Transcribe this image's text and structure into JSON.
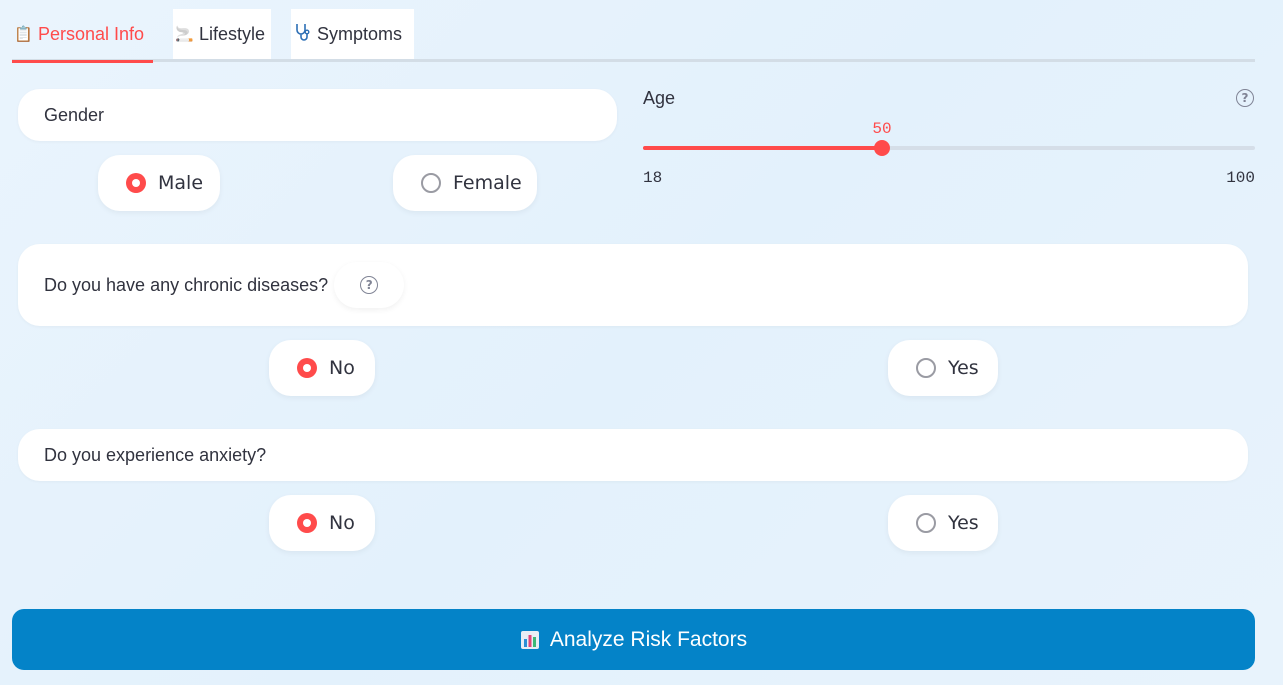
{
  "tabs": [
    {
      "label": "Personal Info",
      "icon": "clipboard-icon",
      "active": true
    },
    {
      "label": "Lifestyle",
      "icon": "cigarette-icon",
      "active": false
    },
    {
      "label": "Symptoms",
      "icon": "stethoscope-icon",
      "active": false
    }
  ],
  "gender": {
    "label": "Gender",
    "options": [
      "Male",
      "Female"
    ],
    "selected": "Male"
  },
  "age": {
    "label": "Age",
    "value": "50",
    "min": "18",
    "max": "100",
    "value_num": 50,
    "min_num": 18,
    "max_num": 100
  },
  "chronic": {
    "label": "Do you have any chronic diseases?",
    "options": [
      "No",
      "Yes"
    ],
    "selected": "No"
  },
  "anxiety": {
    "label": "Do you experience anxiety?",
    "options": [
      "No",
      "Yes"
    ],
    "selected": "No"
  },
  "analyze_button": {
    "label": "Analyze Risk Factors",
    "icon": "bar-chart-icon"
  },
  "colors": {
    "accent": "#ff4b4b",
    "button": "#0483c8",
    "text": "#31333f"
  }
}
